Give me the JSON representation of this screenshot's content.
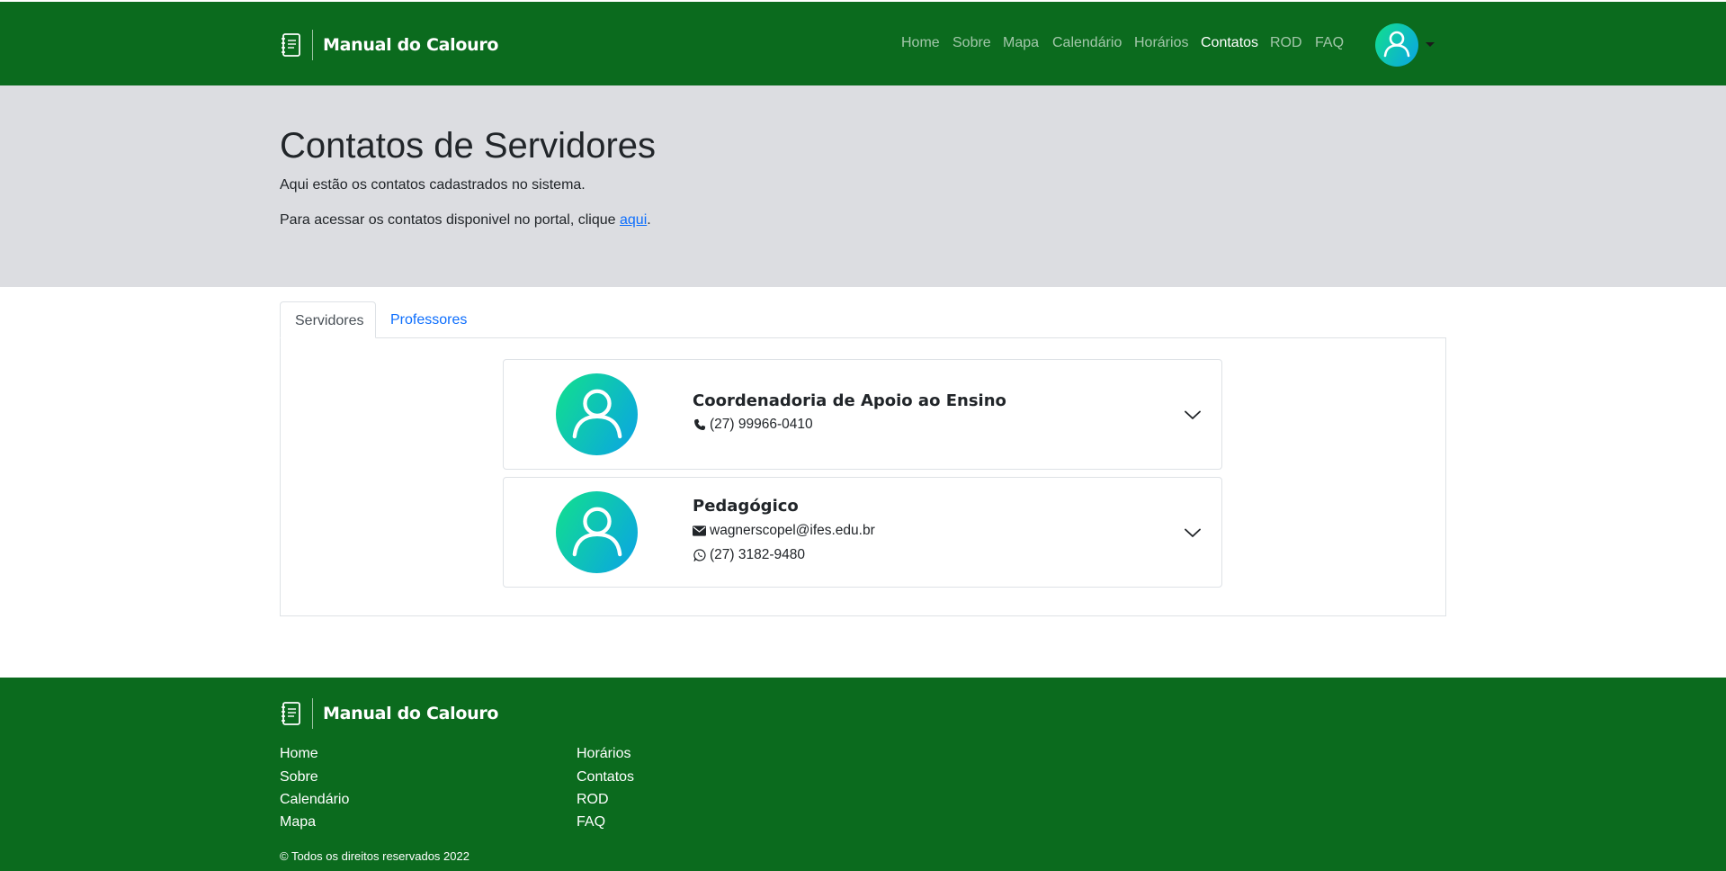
{
  "navbar": {
    "brand": "Manual do Calouro",
    "links": [
      "Home",
      "Sobre",
      "Mapa",
      "Calendário",
      "Horários",
      "Contatos",
      "ROD",
      "FAQ"
    ],
    "active_link": "Contatos"
  },
  "header": {
    "title": "Contatos de Servidores",
    "subtitle": "Aqui estão os contatos cadastrados no sistema.",
    "portal_text": "Para acessar os contatos disponivel no portal, clique ",
    "portal_link": "aqui",
    "portal_suffix": "."
  },
  "tabs": [
    {
      "label": "Servidores",
      "active": true
    },
    {
      "label": "Professores",
      "active": false
    }
  ],
  "contacts": [
    {
      "name": "Coordenadoria de Apoio ao Ensino",
      "phone": "(27) 99966-0410"
    },
    {
      "name": "Pedagógico",
      "email": "wagnerscopel@ifes.edu.br",
      "whatsapp": "(27) 3182-9480"
    }
  ],
  "footer": {
    "brand": "Manual do Calouro",
    "col1": [
      "Home",
      "Sobre",
      "Calendário",
      "Mapa"
    ],
    "col2": [
      "Horários",
      "Contatos",
      "ROD",
      "FAQ"
    ],
    "copyright": "© Todos os direitos reservados 2022"
  },
  "colors": {
    "primary_green": "#0b6b1e",
    "header_gray": "#dcdde1",
    "link_blue": "#0d6efd",
    "avatar_gradient_start": "#12e08c",
    "avatar_gradient_end": "#0aa3e6"
  },
  "icons": [
    "notebook-icon",
    "user-icon",
    "phone-icon",
    "envelope-icon",
    "whatsapp-icon",
    "chevron-down-icon"
  ]
}
